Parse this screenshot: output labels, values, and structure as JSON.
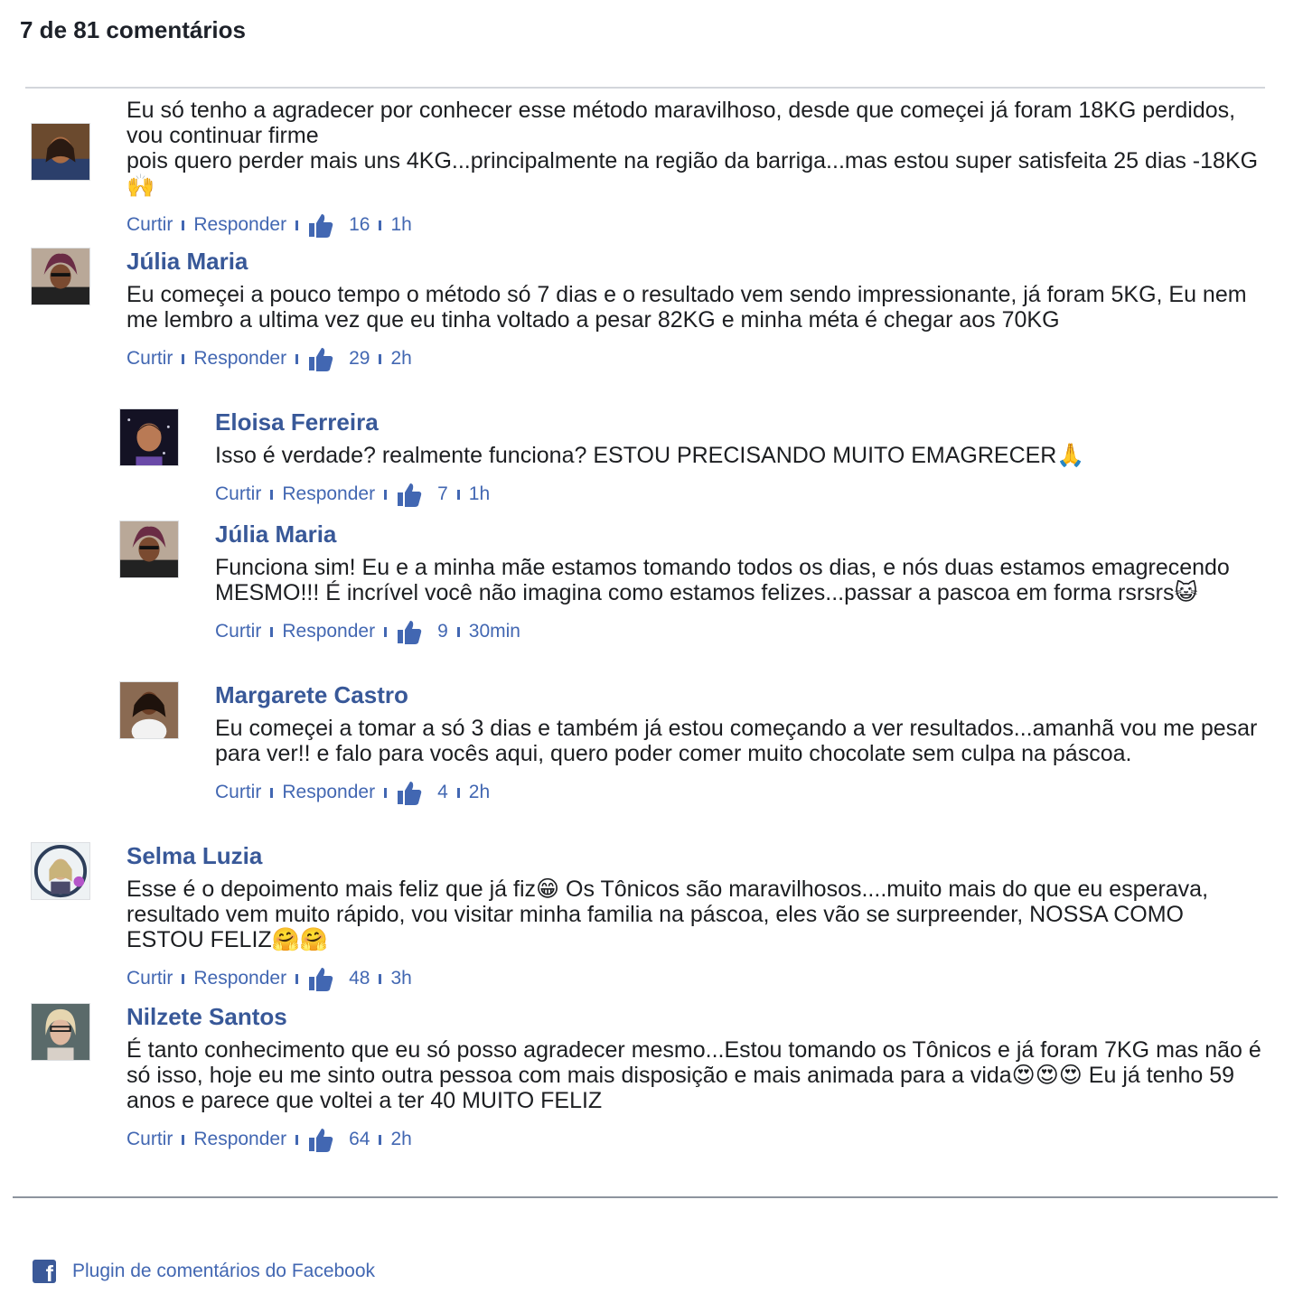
{
  "header": {
    "title": "7 de 81 comentários"
  },
  "action_labels": {
    "like": "Curtir",
    "reply": "Responder"
  },
  "comments": [
    {
      "author": "",
      "text": "Eu só tenho a agradecer por conhecer esse método maravilhoso, desde que começei já foram 18KG perdidos, vou continuar firme\npois quero perder mais uns 4KG...principalmente na região da barriga...mas estou super satisfeita 25 dias -18KG🙌",
      "likes": "16",
      "time": "1h"
    },
    {
      "author": "Júlia Maria",
      "text": "Eu começei a pouco tempo o método só 7 dias e o resultado vem sendo impressionante, já foram 5KG, Eu nem me lembro a ultima vez que eu tinha voltado a pesar 82KG e minha méta é chegar aos 70KG",
      "likes": "29",
      "time": "2h"
    },
    {
      "author": "Eloisa Ferreira",
      "text": "Isso é verdade? realmente funciona? ESTOU PRECISANDO MUITO EMAGRECER🙏",
      "likes": "7",
      "time": "1h"
    },
    {
      "author": "Júlia Maria",
      "text": "Funciona sim! Eu e a minha mãe estamos tomando todos os dias, e nós duas estamos emagrecendo MESMO!!! É incrível você não imagina como estamos felizes...passar a pascoa em forma rsrsrs😺",
      "likes": "9",
      "time": "30min"
    },
    {
      "author": "Margarete Castro",
      "text": "Eu começei a tomar a só 3 dias e também já estou começando a ver resultados...amanhã vou me pesar para ver!! e falo para vocês aqui, quero poder comer muito chocolate sem culpa na páscoa.",
      "likes": "4",
      "time": "2h"
    },
    {
      "author": "Selma Luzia",
      "text": "Esse é o depoimento mais feliz que já fiz😁 Os Tônicos são maravilhosos....muito mais do que eu esperava, resultado vem muito rápido, vou visitar minha familia na páscoa, eles vão se surpreender, NOSSA COMO ESTOU FELIZ🤗🤗",
      "likes": "48",
      "time": "3h"
    },
    {
      "author": "Nilzete Santos",
      "text": "É tanto conhecimento que eu só posso agradecer mesmo...Estou tomando os Tônicos e já foram 7KG mas não é só isso, hoje eu me sinto outra pessoa com mais disposição e mais animada para a vida😍😍😍 Eu já tenho 59 anos e parece que voltei a ter 40 MUITO FELIZ",
      "likes": "64",
      "time": "2h"
    }
  ],
  "footer": {
    "text": "Plugin de comentários do Facebook"
  },
  "colors": {
    "link": "#4267b2",
    "author": "#385898",
    "text": "#1c1e21",
    "facebook": "#3b5998"
  }
}
